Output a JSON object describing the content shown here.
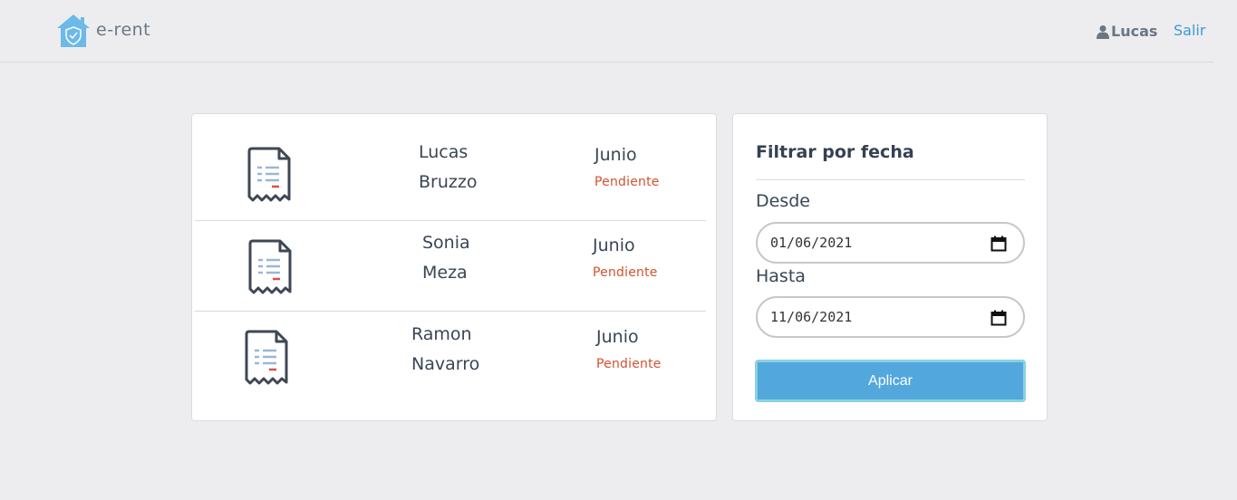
{
  "app": {
    "brand": "e-rent",
    "user_name": "Lucas",
    "logout_label": "Salir"
  },
  "records": [
    {
      "first_name": "Lucas",
      "last_name": "Bruzzo",
      "month": "Junio",
      "status": "Pendiente"
    },
    {
      "first_name": "Sonia",
      "last_name": "Meza",
      "month": "Junio",
      "status": "Pendiente"
    },
    {
      "first_name": "Ramon",
      "last_name": "Navarro",
      "month": "Junio",
      "status": "Pendiente"
    }
  ],
  "filter": {
    "title": "Filtrar por fecha",
    "from_label": "Desde",
    "from_value": "01/06/2021",
    "to_label": "Hasta",
    "to_value": "11/06/2021",
    "apply_label": "Aplicar"
  },
  "colors": {
    "accent": "#52a7dd",
    "status_pending": "#d2522f",
    "link": "#3b9ad4"
  },
  "icons": {
    "brand": "house-shield-icon",
    "user": "user-icon",
    "receipt": "receipt-icon",
    "calendar": "calendar-icon"
  }
}
